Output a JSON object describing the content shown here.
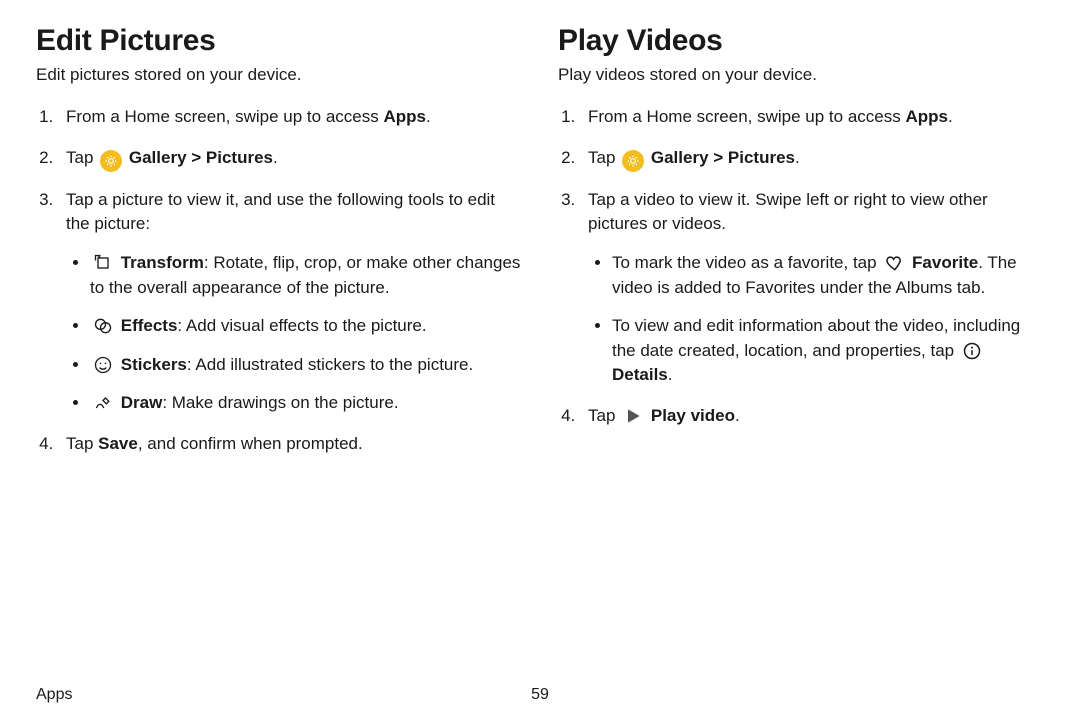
{
  "left": {
    "heading": "Edit Pictures",
    "intro": "Edit pictures stored on your device.",
    "step1_pre": "From a Home screen, swipe up to access ",
    "step1_bold": "Apps",
    "step1_post": ".",
    "step2_pre": "Tap ",
    "step2_bold": "Gallery > Pictures",
    "step2_post": ".",
    "step3": "Tap a picture to view it, and use the following tools to edit the picture:",
    "b1_bold": "Transform",
    "b1_rest": ": Rotate, flip, crop, or make other changes to the overall appearance of the picture.",
    "b2_bold": "Effects",
    "b2_rest": ": Add visual effects to the picture.",
    "b3_bold": "Stickers",
    "b3_rest": ": Add illustrated stickers to the picture.",
    "b4_bold": "Draw",
    "b4_rest": ": Make drawings on the picture.",
    "step4_pre": "Tap ",
    "step4_bold": "Save",
    "step4_post": ", and confirm when prompted."
  },
  "right": {
    "heading": "Play Videos",
    "intro": "Play videos stored on your device.",
    "step1_pre": "From a Home screen, swipe up to access ",
    "step1_bold": "Apps",
    "step1_post": ".",
    "step2_pre": "Tap ",
    "step2_bold": "Gallery > Pictures",
    "step2_post": ".",
    "step3": "Tap a video to view it. Swipe left or right to view other pictures or videos.",
    "b1_pre": "To mark the video as a favorite, tap ",
    "b1_bold": "Favorite",
    "b1_post": ". The video is added to Favorites under the Albums tab.",
    "b2_pre": "To view and edit information about the video, including the date created, location, and properties, tap ",
    "b2_bold": "Details",
    "b2_post": ".",
    "step4_pre": "Tap ",
    "step4_bold": "Play video",
    "step4_post": "."
  },
  "footer": {
    "left": "Apps",
    "page": "59"
  }
}
